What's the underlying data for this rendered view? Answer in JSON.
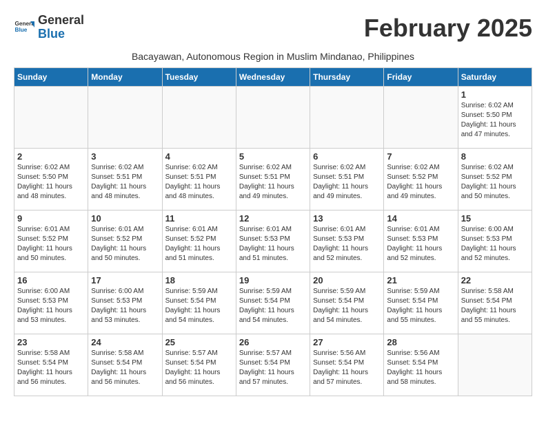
{
  "header": {
    "logo_general": "General",
    "logo_blue": "Blue",
    "month_title": "February 2025",
    "location": "Bacayawan, Autonomous Region in Muslim Mindanao, Philippines"
  },
  "weekdays": [
    "Sunday",
    "Monday",
    "Tuesday",
    "Wednesday",
    "Thursday",
    "Friday",
    "Saturday"
  ],
  "weeks": [
    [
      {
        "day": "",
        "info": ""
      },
      {
        "day": "",
        "info": ""
      },
      {
        "day": "",
        "info": ""
      },
      {
        "day": "",
        "info": ""
      },
      {
        "day": "",
        "info": ""
      },
      {
        "day": "",
        "info": ""
      },
      {
        "day": "1",
        "info": "Sunrise: 6:02 AM\nSunset: 5:50 PM\nDaylight: 11 hours\nand 47 minutes."
      }
    ],
    [
      {
        "day": "2",
        "info": "Sunrise: 6:02 AM\nSunset: 5:50 PM\nDaylight: 11 hours\nand 48 minutes."
      },
      {
        "day": "3",
        "info": "Sunrise: 6:02 AM\nSunset: 5:51 PM\nDaylight: 11 hours\nand 48 minutes."
      },
      {
        "day": "4",
        "info": "Sunrise: 6:02 AM\nSunset: 5:51 PM\nDaylight: 11 hours\nand 48 minutes."
      },
      {
        "day": "5",
        "info": "Sunrise: 6:02 AM\nSunset: 5:51 PM\nDaylight: 11 hours\nand 49 minutes."
      },
      {
        "day": "6",
        "info": "Sunrise: 6:02 AM\nSunset: 5:51 PM\nDaylight: 11 hours\nand 49 minutes."
      },
      {
        "day": "7",
        "info": "Sunrise: 6:02 AM\nSunset: 5:52 PM\nDaylight: 11 hours\nand 49 minutes."
      },
      {
        "day": "8",
        "info": "Sunrise: 6:02 AM\nSunset: 5:52 PM\nDaylight: 11 hours\nand 50 minutes."
      }
    ],
    [
      {
        "day": "9",
        "info": "Sunrise: 6:01 AM\nSunset: 5:52 PM\nDaylight: 11 hours\nand 50 minutes."
      },
      {
        "day": "10",
        "info": "Sunrise: 6:01 AM\nSunset: 5:52 PM\nDaylight: 11 hours\nand 50 minutes."
      },
      {
        "day": "11",
        "info": "Sunrise: 6:01 AM\nSunset: 5:52 PM\nDaylight: 11 hours\nand 51 minutes."
      },
      {
        "day": "12",
        "info": "Sunrise: 6:01 AM\nSunset: 5:53 PM\nDaylight: 11 hours\nand 51 minutes."
      },
      {
        "day": "13",
        "info": "Sunrise: 6:01 AM\nSunset: 5:53 PM\nDaylight: 11 hours\nand 52 minutes."
      },
      {
        "day": "14",
        "info": "Sunrise: 6:01 AM\nSunset: 5:53 PM\nDaylight: 11 hours\nand 52 minutes."
      },
      {
        "day": "15",
        "info": "Sunrise: 6:00 AM\nSunset: 5:53 PM\nDaylight: 11 hours\nand 52 minutes."
      }
    ],
    [
      {
        "day": "16",
        "info": "Sunrise: 6:00 AM\nSunset: 5:53 PM\nDaylight: 11 hours\nand 53 minutes."
      },
      {
        "day": "17",
        "info": "Sunrise: 6:00 AM\nSunset: 5:53 PM\nDaylight: 11 hours\nand 53 minutes."
      },
      {
        "day": "18",
        "info": "Sunrise: 5:59 AM\nSunset: 5:54 PM\nDaylight: 11 hours\nand 54 minutes."
      },
      {
        "day": "19",
        "info": "Sunrise: 5:59 AM\nSunset: 5:54 PM\nDaylight: 11 hours\nand 54 minutes."
      },
      {
        "day": "20",
        "info": "Sunrise: 5:59 AM\nSunset: 5:54 PM\nDaylight: 11 hours\nand 54 minutes."
      },
      {
        "day": "21",
        "info": "Sunrise: 5:59 AM\nSunset: 5:54 PM\nDaylight: 11 hours\nand 55 minutes."
      },
      {
        "day": "22",
        "info": "Sunrise: 5:58 AM\nSunset: 5:54 PM\nDaylight: 11 hours\nand 55 minutes."
      }
    ],
    [
      {
        "day": "23",
        "info": "Sunrise: 5:58 AM\nSunset: 5:54 PM\nDaylight: 11 hours\nand 56 minutes."
      },
      {
        "day": "24",
        "info": "Sunrise: 5:58 AM\nSunset: 5:54 PM\nDaylight: 11 hours\nand 56 minutes."
      },
      {
        "day": "25",
        "info": "Sunrise: 5:57 AM\nSunset: 5:54 PM\nDaylight: 11 hours\nand 56 minutes."
      },
      {
        "day": "26",
        "info": "Sunrise: 5:57 AM\nSunset: 5:54 PM\nDaylight: 11 hours\nand 57 minutes."
      },
      {
        "day": "27",
        "info": "Sunrise: 5:56 AM\nSunset: 5:54 PM\nDaylight: 11 hours\nand 57 minutes."
      },
      {
        "day": "28",
        "info": "Sunrise: 5:56 AM\nSunset: 5:54 PM\nDaylight: 11 hours\nand 58 minutes."
      },
      {
        "day": "",
        "info": ""
      }
    ]
  ]
}
